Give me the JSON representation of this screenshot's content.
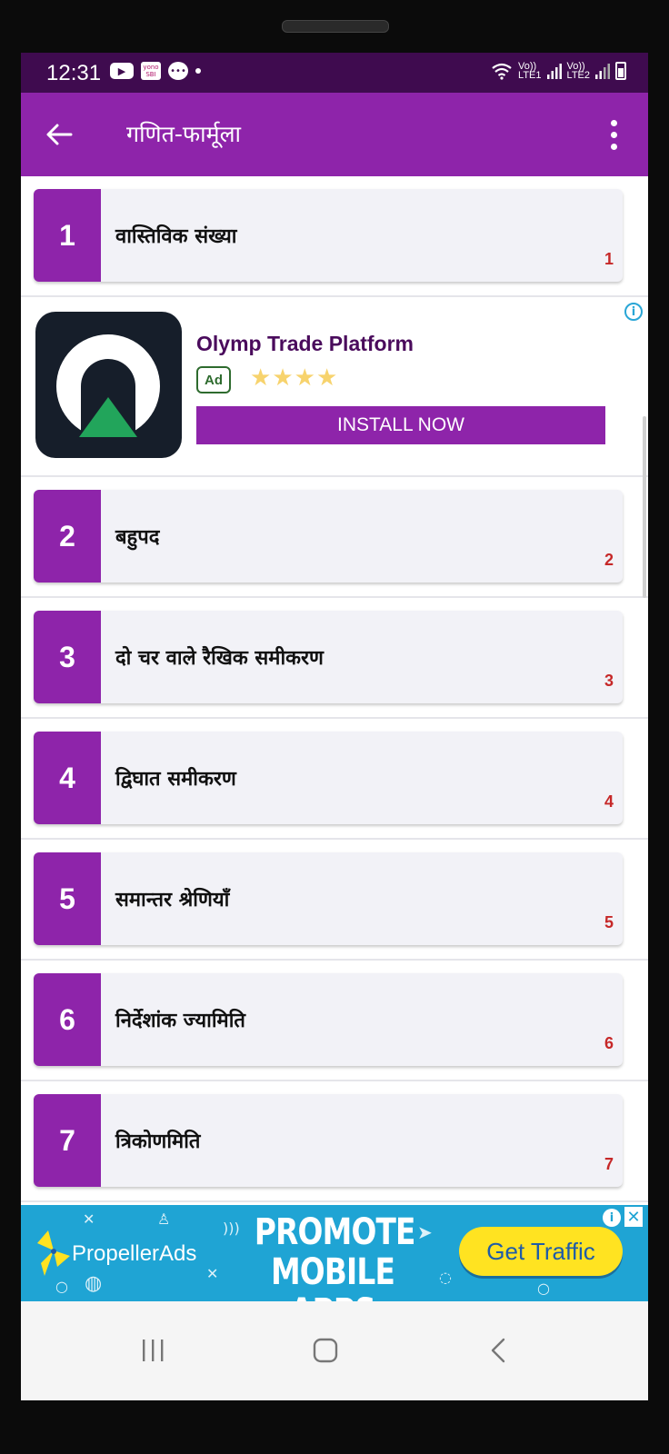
{
  "status_bar": {
    "time": "12:31",
    "icons_left": [
      "youtube-icon",
      "yono-sbi-icon",
      "chat-icon",
      "dot-icon"
    ],
    "yono_line1": "yono",
    "yono_line2": "SBI",
    "sim1_label_top": "Vo))",
    "sim1_label_bottom": "LTE1",
    "sim2_label_top": "Vo))",
    "sim2_label_bottom": "LTE2"
  },
  "appbar": {
    "title": "गणित-फार्मूला",
    "back_icon": "arrow-left-icon",
    "menu_icon": "more-vert-icon"
  },
  "topics": [
    {
      "number": "1",
      "title": "वास्तिविक संख्या",
      "index": "1"
    },
    {
      "number": "2",
      "title": "बहुपद",
      "index": "2"
    },
    {
      "number": "3",
      "title": "दो चर वाले रैखिक समीकरण",
      "index": "3"
    },
    {
      "number": "4",
      "title": "द्विघात समीकरण",
      "index": "4"
    },
    {
      "number": "5",
      "title": "समान्तर श्रेणियाँ",
      "index": "5"
    },
    {
      "number": "6",
      "title": "निर्देशांक ज्यामिति",
      "index": "6"
    },
    {
      "number": "7",
      "title": "त्रिकोणमिति",
      "index": "7"
    }
  ],
  "native_ad": {
    "title": "Olymp Trade Platform",
    "badge": "Ad",
    "rating_stars": 4,
    "install_label": "INSTALL NOW",
    "info_icon": "info-icon",
    "colors": {
      "button": "#8e24aa",
      "title": "#4a0b5c",
      "star": "#f7d36d",
      "logo_bg": "#161e2a",
      "logo_triangle": "#22a55b"
    }
  },
  "banner_ad": {
    "brand": "PropellerAds",
    "headline_line1": "PROMOTE",
    "headline_line2": "MOBILE APPS",
    "cta": "Get Traffic",
    "colors": {
      "background": "#1fa4d4",
      "cta_bg": "#ffe321",
      "cta_text": "#1f5ca8",
      "logo_yellow": "#ffe321"
    }
  },
  "navbar": {
    "recents_icon": "recents-icon",
    "home_icon": "home-icon",
    "back_icon": "back-chevron-icon"
  },
  "theme": {
    "primary": "#8e24aa",
    "status_bar": "#3f0b4f",
    "index_red": "#c62828",
    "card_bg": "#f2f2f7"
  }
}
